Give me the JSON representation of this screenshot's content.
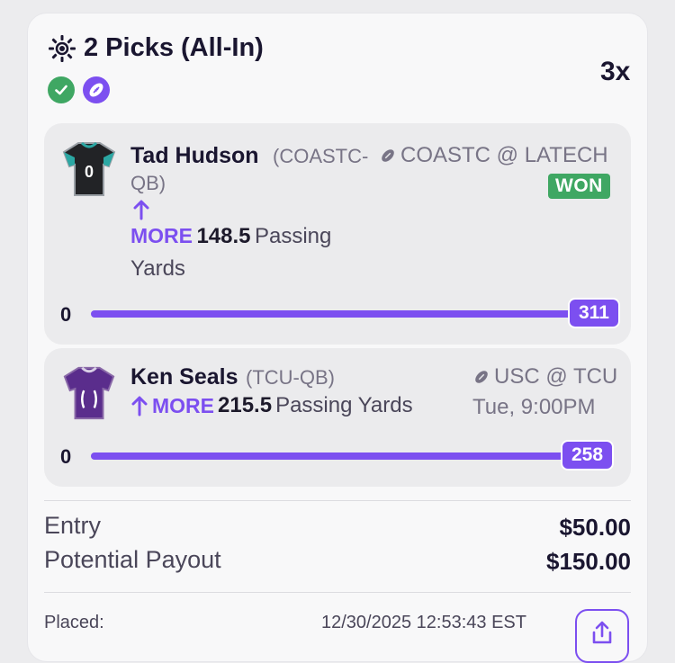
{
  "header": {
    "title": "2 Picks (All-In)",
    "multiplier": "3x",
    "icon": "sun-gear-icon"
  },
  "badges": [
    {
      "icon": "check-icon",
      "color": "#3fa763"
    },
    {
      "icon": "football-icon",
      "color": "#7c4ff0"
    }
  ],
  "picks": [
    {
      "player": "Tad Hudson",
      "team_pos_a": "(COASTC-",
      "team_pos_b": "QB)",
      "matchup": "COASTC @ LATECH",
      "status": "WON",
      "direction": "MORE",
      "line": "148.5",
      "stat_a": "Passing",
      "stat_b": "Yards",
      "min": "0",
      "result": "311",
      "progress": 1.0,
      "jersey_color": "#222326",
      "jersey_accent": "#2ba7a3",
      "jersey_number": "0"
    },
    {
      "player": "Ken Seals",
      "team_pos": "(TCU-QB)",
      "matchup": "USC @ TCU",
      "time": "Tue, 9:00PM",
      "direction": "MORE",
      "line": "215.5",
      "stat": "Passing Yards",
      "min": "0",
      "result": "258",
      "progress": 1.0,
      "jersey_color": "#5a2d8c"
    }
  ],
  "summary": {
    "entry_label": "Entry",
    "entry_value": "$50.00",
    "payout_label": "Potential Payout",
    "payout_value": "$150.00",
    "placed_label": "Placed:",
    "placed_value": "12/30/2025 12:53:43 EST"
  },
  "colors": {
    "accent": "#7c4ff0",
    "won": "#3fa763"
  }
}
